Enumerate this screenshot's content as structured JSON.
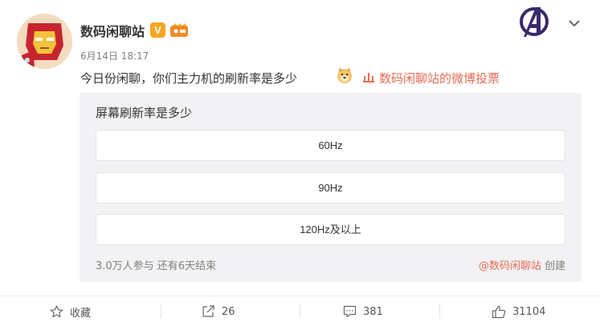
{
  "user": {
    "name": "数码闲聊站",
    "verified_badge": "V",
    "avatar_icon": "iron-man-avatar"
  },
  "post": {
    "date": "6月14日",
    "time": "18:17",
    "text": "今日份闲聊，你们主力机的刷新率是多少",
    "emoji": "doge-emoji",
    "source_icon": "poll-source-icon",
    "source": "数码闲聊站的微博投票"
  },
  "poll": {
    "title": "屏幕刷新率是多少",
    "options": [
      {
        "label": "60Hz"
      },
      {
        "label": "90Hz"
      },
      {
        "label": "120Hz及以上"
      }
    ],
    "stats": "3.0万人参与 还有6天结束",
    "creator": "@数码闲聊站",
    "creator_suffix": "创建"
  },
  "actions": {
    "favorite_label": "收藏",
    "share_count": "26",
    "comment_count": "381",
    "like_count": "31104"
  },
  "colors": {
    "accent": "#e86b54",
    "badge_orange": "#f6a623",
    "poll_bg": "#f2f2f5"
  }
}
